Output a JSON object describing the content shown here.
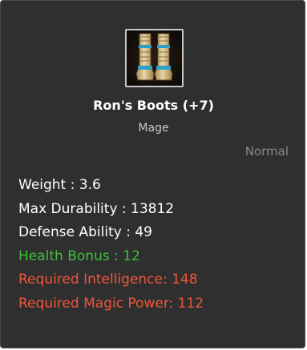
{
  "item": {
    "icon": "boots-icon",
    "name": "Ron's Boots (+7)",
    "class": "Mage",
    "grade": "Normal"
  },
  "stats": [
    {
      "text": "Weight : 3.6",
      "color": "#ffffff"
    },
    {
      "text": "Max Durability : 13812",
      "color": "#ffffff"
    },
    {
      "text": "Defense Ability : 49",
      "color": "#ffffff"
    },
    {
      "text": "Health Bonus : 12",
      "color": "#3fbf3a"
    },
    {
      "text": "Required Intelligence: 148",
      "color": "#f0563b"
    },
    {
      "text": "Required Magic Power: 112",
      "color": "#f0563b"
    }
  ],
  "colors": {
    "background": "#2f2f2f",
    "title": "#ffffff",
    "subtitle": "#c8c8c8",
    "grade": "#8a8a8a",
    "bonus": "#3fbf3a",
    "requirement": "#f0563b"
  }
}
